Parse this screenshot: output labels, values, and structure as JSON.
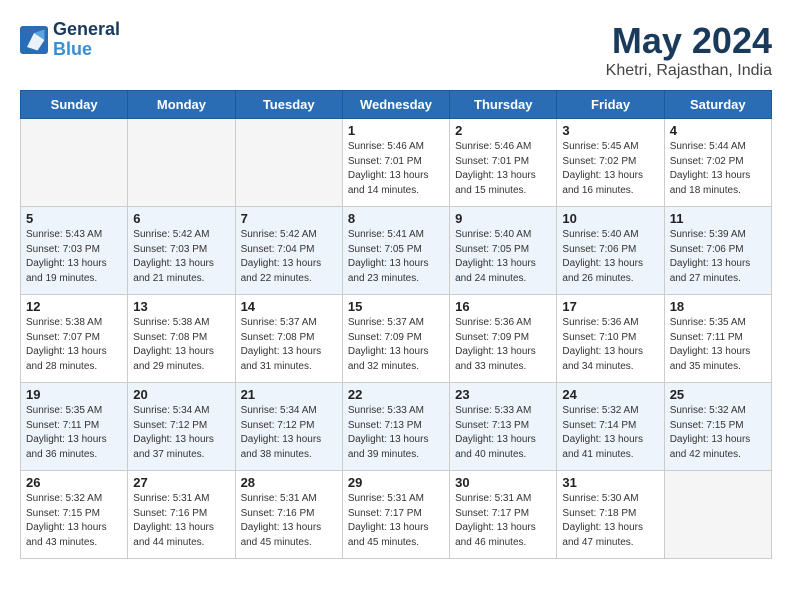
{
  "header": {
    "logo_line1": "General",
    "logo_line2": "Blue",
    "month_title": "May 2024",
    "location": "Khetri, Rajasthan, India"
  },
  "days_of_week": [
    "Sunday",
    "Monday",
    "Tuesday",
    "Wednesday",
    "Thursday",
    "Friday",
    "Saturday"
  ],
  "weeks": [
    [
      {
        "day": "",
        "empty": true
      },
      {
        "day": "",
        "empty": true
      },
      {
        "day": "",
        "empty": true
      },
      {
        "day": "1",
        "sunrise": "5:46 AM",
        "sunset": "7:01 PM",
        "daylight": "13 hours and 14 minutes."
      },
      {
        "day": "2",
        "sunrise": "5:46 AM",
        "sunset": "7:01 PM",
        "daylight": "13 hours and 15 minutes."
      },
      {
        "day": "3",
        "sunrise": "5:45 AM",
        "sunset": "7:02 PM",
        "daylight": "13 hours and 16 minutes."
      },
      {
        "day": "4",
        "sunrise": "5:44 AM",
        "sunset": "7:02 PM",
        "daylight": "13 hours and 18 minutes."
      }
    ],
    [
      {
        "day": "5",
        "sunrise": "5:43 AM",
        "sunset": "7:03 PM",
        "daylight": "13 hours and 19 minutes."
      },
      {
        "day": "6",
        "sunrise": "5:42 AM",
        "sunset": "7:03 PM",
        "daylight": "13 hours and 21 minutes."
      },
      {
        "day": "7",
        "sunrise": "5:42 AM",
        "sunset": "7:04 PM",
        "daylight": "13 hours and 22 minutes."
      },
      {
        "day": "8",
        "sunrise": "5:41 AM",
        "sunset": "7:05 PM",
        "daylight": "13 hours and 23 minutes."
      },
      {
        "day": "9",
        "sunrise": "5:40 AM",
        "sunset": "7:05 PM",
        "daylight": "13 hours and 24 minutes."
      },
      {
        "day": "10",
        "sunrise": "5:40 AM",
        "sunset": "7:06 PM",
        "daylight": "13 hours and 26 minutes."
      },
      {
        "day": "11",
        "sunrise": "5:39 AM",
        "sunset": "7:06 PM",
        "daylight": "13 hours and 27 minutes."
      }
    ],
    [
      {
        "day": "12",
        "sunrise": "5:38 AM",
        "sunset": "7:07 PM",
        "daylight": "13 hours and 28 minutes."
      },
      {
        "day": "13",
        "sunrise": "5:38 AM",
        "sunset": "7:08 PM",
        "daylight": "13 hours and 29 minutes."
      },
      {
        "day": "14",
        "sunrise": "5:37 AM",
        "sunset": "7:08 PM",
        "daylight": "13 hours and 31 minutes."
      },
      {
        "day": "15",
        "sunrise": "5:37 AM",
        "sunset": "7:09 PM",
        "daylight": "13 hours and 32 minutes."
      },
      {
        "day": "16",
        "sunrise": "5:36 AM",
        "sunset": "7:09 PM",
        "daylight": "13 hours and 33 minutes."
      },
      {
        "day": "17",
        "sunrise": "5:36 AM",
        "sunset": "7:10 PM",
        "daylight": "13 hours and 34 minutes."
      },
      {
        "day": "18",
        "sunrise": "5:35 AM",
        "sunset": "7:11 PM",
        "daylight": "13 hours and 35 minutes."
      }
    ],
    [
      {
        "day": "19",
        "sunrise": "5:35 AM",
        "sunset": "7:11 PM",
        "daylight": "13 hours and 36 minutes."
      },
      {
        "day": "20",
        "sunrise": "5:34 AM",
        "sunset": "7:12 PM",
        "daylight": "13 hours and 37 minutes."
      },
      {
        "day": "21",
        "sunrise": "5:34 AM",
        "sunset": "7:12 PM",
        "daylight": "13 hours and 38 minutes."
      },
      {
        "day": "22",
        "sunrise": "5:33 AM",
        "sunset": "7:13 PM",
        "daylight": "13 hours and 39 minutes."
      },
      {
        "day": "23",
        "sunrise": "5:33 AM",
        "sunset": "7:13 PM",
        "daylight": "13 hours and 40 minutes."
      },
      {
        "day": "24",
        "sunrise": "5:32 AM",
        "sunset": "7:14 PM",
        "daylight": "13 hours and 41 minutes."
      },
      {
        "day": "25",
        "sunrise": "5:32 AM",
        "sunset": "7:15 PM",
        "daylight": "13 hours and 42 minutes."
      }
    ],
    [
      {
        "day": "26",
        "sunrise": "5:32 AM",
        "sunset": "7:15 PM",
        "daylight": "13 hours and 43 minutes."
      },
      {
        "day": "27",
        "sunrise": "5:31 AM",
        "sunset": "7:16 PM",
        "daylight": "13 hours and 44 minutes."
      },
      {
        "day": "28",
        "sunrise": "5:31 AM",
        "sunset": "7:16 PM",
        "daylight": "13 hours and 45 minutes."
      },
      {
        "day": "29",
        "sunrise": "5:31 AM",
        "sunset": "7:17 PM",
        "daylight": "13 hours and 45 minutes."
      },
      {
        "day": "30",
        "sunrise": "5:31 AM",
        "sunset": "7:17 PM",
        "daylight": "13 hours and 46 minutes."
      },
      {
        "day": "31",
        "sunrise": "5:30 AM",
        "sunset": "7:18 PM",
        "daylight": "13 hours and 47 minutes."
      },
      {
        "day": "",
        "empty": true
      }
    ]
  ]
}
